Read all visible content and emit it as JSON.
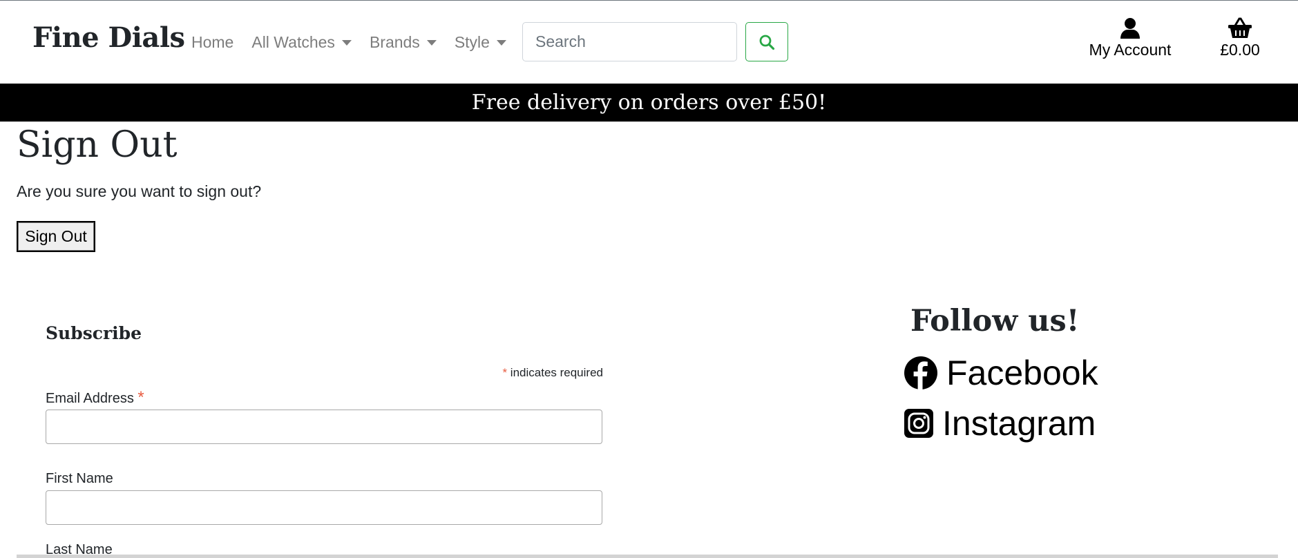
{
  "header": {
    "brand": "Fine Dials",
    "nav": [
      {
        "label": "Home",
        "has_dropdown": false
      },
      {
        "label": "All Watches",
        "has_dropdown": true
      },
      {
        "label": "Brands",
        "has_dropdown": true
      },
      {
        "label": "Style",
        "has_dropdown": true
      }
    ],
    "search": {
      "placeholder": "Search",
      "value": "",
      "icon": "search-icon"
    },
    "account": {
      "label": "My Account",
      "icon": "user-icon"
    },
    "basket": {
      "label": "£0.00",
      "icon": "basket-icon"
    }
  },
  "banner": {
    "text": "Free delivery on orders over £50!"
  },
  "main": {
    "title": "Sign Out",
    "message": "Are you sure you want to sign out?",
    "button_label": "Sign Out"
  },
  "subscribe": {
    "title": "Subscribe",
    "required_marker": "*",
    "required_note": "indicates required",
    "fields": [
      {
        "label": "Email Address",
        "required": true,
        "value": ""
      },
      {
        "label": "First Name",
        "required": false,
        "value": ""
      },
      {
        "label": "Last Name",
        "required": false,
        "value": ""
      }
    ]
  },
  "social": {
    "title": "Follow us!",
    "links": [
      {
        "label": "Facebook",
        "icon": "facebook-icon"
      },
      {
        "label": "Instagram",
        "icon": "instagram-icon"
      }
    ]
  },
  "colors": {
    "accent_green": "#28a745",
    "banner_bg": "#000000",
    "required_red": "#e85c41"
  }
}
